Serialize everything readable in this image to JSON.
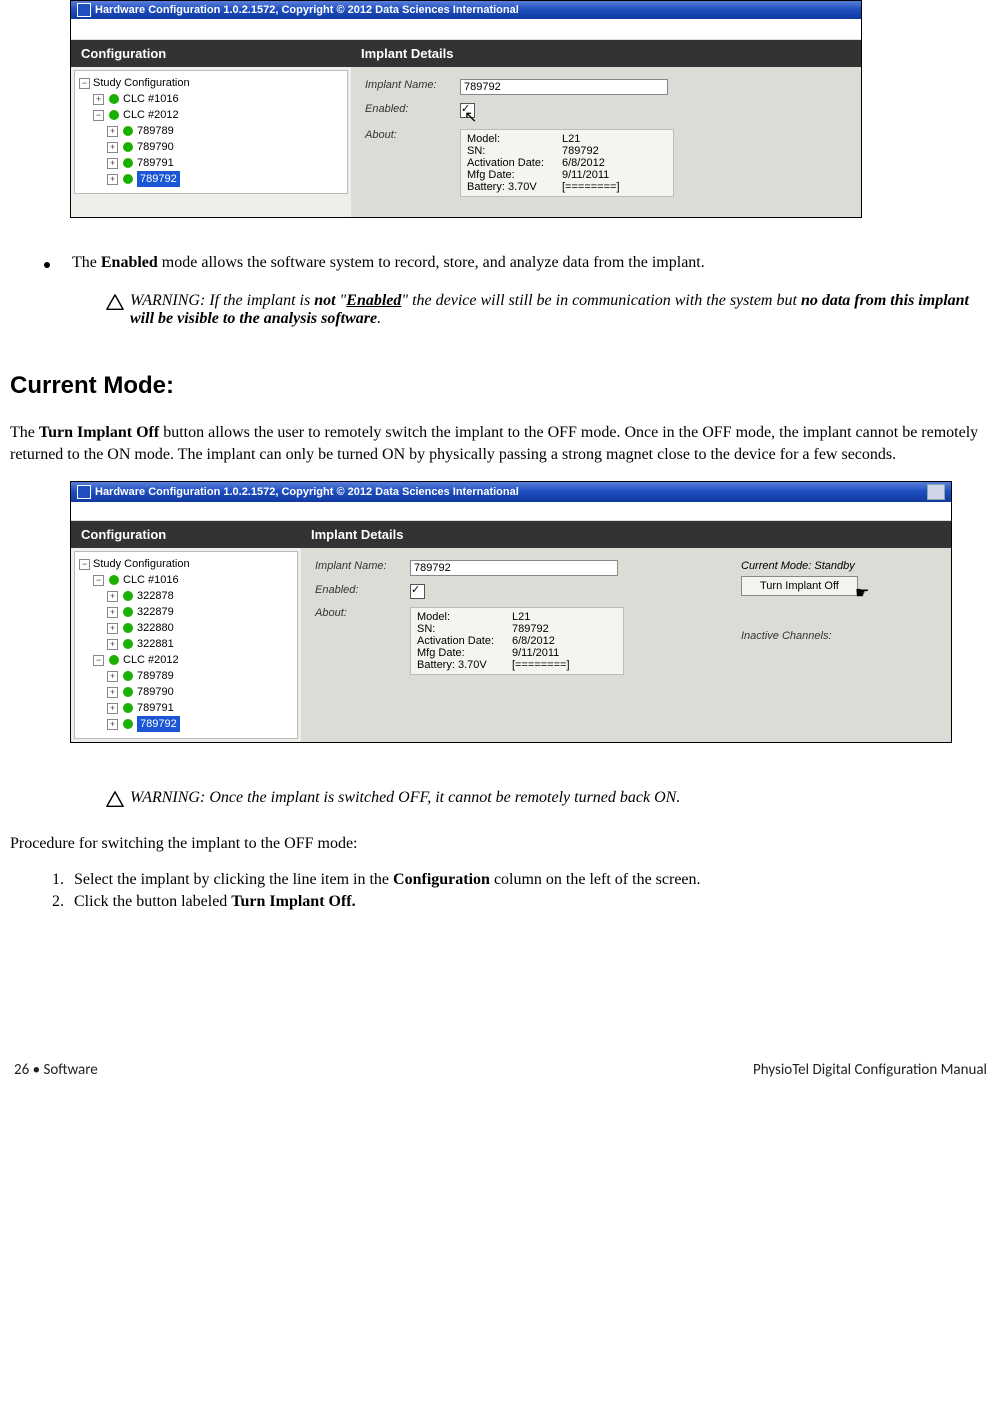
{
  "app1": {
    "title": "Hardware Configuration 1.0.2.1572, Copyright © 2012 Data Sciences International",
    "conf_header": "Configuration",
    "details_header": "Implant Details",
    "tree": {
      "root": "Study Configuration",
      "clc1": "CLC #1016",
      "clc2": "CLC #2012",
      "imp1": "789789",
      "imp2": "789790",
      "imp3": "789791",
      "imp4": "789792"
    },
    "form": {
      "name_label": "Implant Name:",
      "name_value": "789792",
      "enabled_label": "Enabled:",
      "about_label": "About:",
      "about": {
        "model_k": "Model:",
        "model_v": "L21",
        "sn_k": "SN:",
        "sn_v": "789792",
        "act_k": "Activation Date:",
        "act_v": "6/8/2012",
        "mfg_k": "Mfg Date:",
        "mfg_v": "9/11/2011",
        "bat_k": "Battery: 3.70V",
        "bat_v": "[========]"
      }
    }
  },
  "body": {
    "bullet1a": "The ",
    "bullet1b": "Enabled",
    "bullet1c": " mode allows the software system to record, store, and analyze data from the implant.",
    "warn1a": "WARNING: If the implant is ",
    "warn1b": "not",
    "warn1c": " \"",
    "warn1d": "Enabled",
    "warn1e": "\" the device will still be in communication with the system but ",
    "warn1f": "no data from this implant will be visible to the analysis software",
    "warn1g": ".",
    "h2": "Current Mode:",
    "para_a": "The ",
    "para_b": "Turn Implant Off",
    "para_c": " button allows the user to remotely switch the implant to the OFF mode.  Once in the OFF mode, the implant cannot be remotely returned to the ON mode.  The implant can only be turned ON by physically passing a strong magnet close to the device for a few seconds.",
    "warn2": "WARNING: Once the implant is switched OFF, it cannot be remotely turned back ON.",
    "proc_intro": "Procedure for switching the implant to the OFF mode:",
    "step1a": "Select the implant by clicking the line item in the ",
    "step1b": "Configuration",
    "step1c": " column on the left of the screen.",
    "step2a": "Click the button labeled ",
    "step2b": "Turn Implant Off."
  },
  "app2": {
    "title": "Hardware Configuration 1.0.2.1572, Copyright © 2012 Data Sciences International",
    "conf_header": "Configuration",
    "details_header": "Implant Details",
    "tree": {
      "root": "Study Configuration",
      "clc1": "CLC #1016",
      "i11": "322878",
      "i12": "322879",
      "i13": "322880",
      "i14": "322881",
      "clc2": "CLC #2012",
      "i21": "789789",
      "i22": "789790",
      "i23": "789791",
      "i24": "789792"
    },
    "form": {
      "name_label": "Implant Name:",
      "name_value": "789792",
      "enabled_label": "Enabled:",
      "about_label": "About:",
      "about": {
        "model_k": "Model:",
        "model_v": "L21",
        "sn_k": "SN:",
        "sn_v": "789792",
        "act_k": "Activation Date:",
        "act_v": "6/8/2012",
        "mfg_k": "Mfg Date:",
        "mfg_v": "9/11/2011",
        "bat_k": "Battery: 3.70V",
        "bat_v": "[========]"
      }
    },
    "mode_label": "Current Mode: Standby",
    "turn_off_btn": "Turn Implant Off",
    "inactive_label": "Inactive Channels:"
  },
  "footer": {
    "left_a": "26  •  Software",
    "right": "PhysioTel Digital Configuration Manual"
  }
}
